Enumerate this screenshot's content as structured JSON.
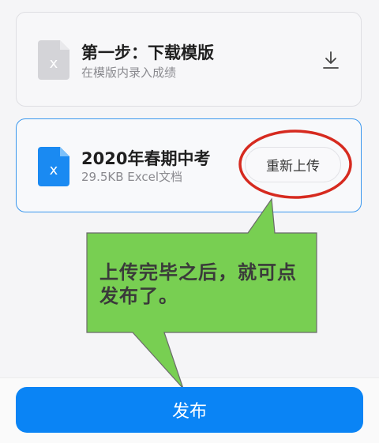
{
  "step_card": {
    "title": "第一步：下载模版",
    "subtitle": "在模版内录入成绩",
    "file_icon": "excel-file-icon-gray",
    "download_icon": "download-icon"
  },
  "file_card": {
    "title": "2020年春期中考",
    "subtitle": "29.5KB Excel文档",
    "file_icon": "excel-file-icon-blue",
    "reupload_label": "重新上传"
  },
  "annotation": {
    "text": "上传完毕之后，就可点发布了。"
  },
  "publish_label": "发布",
  "colors": {
    "accent": "#0a84f5",
    "callout_fill": "#78cf52",
    "ring": "#d62a1f"
  }
}
